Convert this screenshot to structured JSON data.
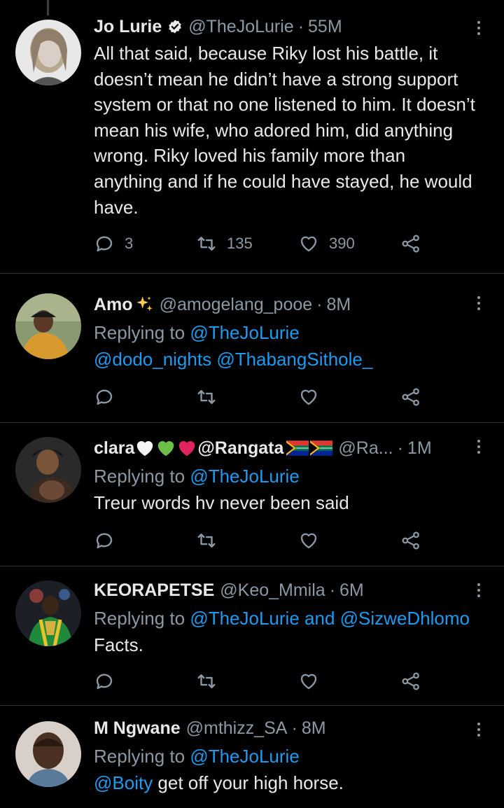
{
  "tweets": [
    {
      "name": "Jo Lurie",
      "verified": true,
      "handle": "@TheJoLurie",
      "separator": "·",
      "time": "55M",
      "text": "All that said, because Riky lost his battle, it doesn’t mean he didn’t have a strong support system or that no one listened to him. It doesn’t mean his wife, who adored him, did anything wrong. Riky loved his family more than anything and if he could have stayed, he would have.",
      "replies": "3",
      "retweets": "135",
      "likes": "390"
    },
    {
      "name": "Amo",
      "name_emoji": "sparkles",
      "handle": "@amogelang_pooe",
      "separator": "·",
      "time": "8M",
      "replying_label": "Replying to",
      "replying_to": "@TheJoLurie",
      "mention_1": "@dodo_nights",
      "mention_2": "@ThabangSithole_"
    },
    {
      "name": "clara",
      "name_suffix": "@Rangata",
      "name_emojis": [
        "white-heart",
        "green-heart",
        "red-heart",
        "south-africa-flag",
        "south-africa-flag"
      ],
      "handle": "@Ra...",
      "separator": "·",
      "time": "1M",
      "replying_label": "Replying to",
      "replying_to": "@TheJoLurie",
      "text": "Treur words hv never been said"
    },
    {
      "name": "KEORAPETSE",
      "handle": "@Keo_Mmila",
      "separator": "·",
      "time": "6M",
      "replying_label": "Replying to",
      "replying_to": "@TheJoLurie",
      "replying_and": "and",
      "replying_to_2": "@SizweDhlomo",
      "text": "Facts."
    },
    {
      "name": "M Ngwane",
      "handle": "@mthizz_SA",
      "separator": "·",
      "time": "8M",
      "replying_label": "Replying to",
      "replying_to": "@TheJoLurie",
      "mention": "@Boity",
      "text": " get off your high horse."
    }
  ],
  "colors": {
    "background": "#000000",
    "text": "#e7e9ea",
    "secondary": "#8b98a5",
    "link": "#1d9bf0",
    "divider": "#2f3336",
    "verified": "#e7e9ea"
  }
}
